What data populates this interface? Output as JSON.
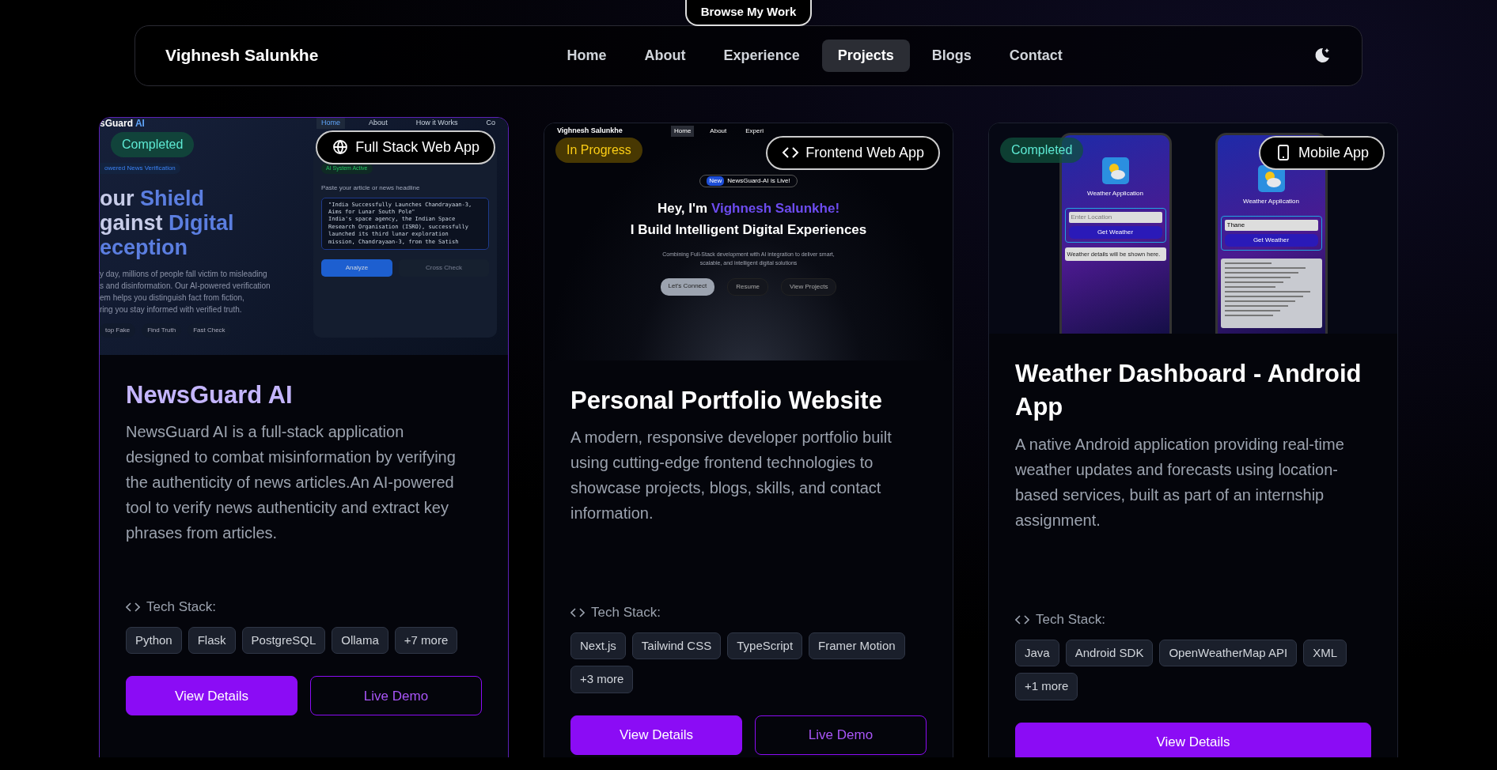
{
  "top_pill": {
    "label": "Browse My Work"
  },
  "navbar": {
    "brand": "Vighnesh Salunkhe",
    "links": [
      {
        "label": "Home",
        "selected": false
      },
      {
        "label": "About",
        "selected": false
      },
      {
        "label": "Experience",
        "selected": false
      },
      {
        "label": "Projects",
        "selected": true
      },
      {
        "label": "Blogs",
        "selected": false
      },
      {
        "label": "Contact",
        "selected": false
      }
    ]
  },
  "projects": [
    {
      "hovered": true,
      "status": {
        "label": "Completed",
        "kind": "completed"
      },
      "type": {
        "label": "Full Stack Web App",
        "kind": "web"
      },
      "preview": {
        "kind": "newsguard",
        "logo": "sGuard",
        "logo_accent": "AI",
        "nav": [
          {
            "label": "Home",
            "selected": true
          },
          {
            "label": "About",
            "selected": false
          },
          {
            "label": "How it Works",
            "selected": false
          },
          {
            "label": "Co",
            "selected": false
          }
        ],
        "badge": "owered News Verification",
        "heading_lines": [
          [
            {
              "text": "our ",
              "accent": false
            },
            {
              "text": "Shield",
              "accent": true
            }
          ],
          [
            {
              "text": "gainst ",
              "accent": false
            },
            {
              "text": "Digital",
              "accent": true
            }
          ],
          [
            {
              "text": "eception",
              "accent": true
            }
          ]
        ],
        "paragraph_lines": [
          "y day, millions of people fall victim to misleading",
          "s and disinformation. Our AI-powered verification",
          "em helps you distinguish fact from fiction,",
          "ring you stay informed with verified truth."
        ],
        "chips": [
          "top Fake",
          "Find Truth",
          "Fast Check"
        ],
        "panel_status": "AI System Active",
        "panel_label": "Paste your article or news headline",
        "textarea_lines": [
          "\"India Successfully Launches Chandrayaan-3,",
          "Aims for Lunar South Pole\"",
          "India's space agency, the Indian Space",
          "Research Organisation (ISRO), successfully",
          "launched its third lunar exploration",
          "mission, Chandrayaan-3, from the Satish"
        ],
        "analyze": "Analyze",
        "cross_check": "Cross Check"
      },
      "title": "NewsGuard AI",
      "description": "NewsGuard AI is a full-stack application designed to combat misinformation by verifying the authenticity of news articles.An AI-powered tool to verify news authenticity and extract key phrases from articles.",
      "tech_label": "Tech Stack:",
      "tech": [
        "Python",
        "Flask",
        "PostgreSQL",
        "Ollama",
        "+7 more"
      ],
      "buttons": [
        {
          "label": "View Details",
          "kind": "primary"
        },
        {
          "label": "Live Demo",
          "kind": "outline"
        }
      ]
    },
    {
      "hovered": false,
      "status": {
        "label": "In Progress",
        "kind": "progress"
      },
      "type": {
        "label": "Frontend Web App",
        "kind": "code"
      },
      "preview": {
        "kind": "portfolio",
        "brand": "Vighnesh Salunkhe",
        "nav": [
          {
            "label": "Home",
            "selected": true
          },
          {
            "label": "About",
            "selected": false
          },
          {
            "label": "Experi",
            "selected": false
          }
        ],
        "pill_tag": "New",
        "pill_text": "NewsGuard-AI is Live!",
        "intro": "Hey, I'm ",
        "name": "Vighnesh Salunkhe!",
        "headline": "I Build Intelligent Digital Experiences",
        "subtitle": "Combining Full-Stack development with AI integration to deliver smart, scalable, and intelligent digital solutions",
        "buttons": [
          "Let's Connect",
          "Resume",
          "View Projects"
        ]
      },
      "title": "Personal Portfolio Website",
      "description": "A modern, responsive developer portfolio built using cutting-edge frontend technologies to showcase projects, blogs, skills, and contact information.",
      "tech_label": "Tech Stack:",
      "tech": [
        "Next.js",
        "Tailwind CSS",
        "TypeScript",
        "Framer Motion",
        "+3 more"
      ],
      "buttons": [
        {
          "label": "View Details",
          "kind": "primary"
        },
        {
          "label": "Live Demo",
          "kind": "outline"
        }
      ]
    },
    {
      "hovered": false,
      "status": {
        "label": "Completed",
        "kind": "completed"
      },
      "type": {
        "label": "Mobile App",
        "kind": "mobile"
      },
      "preview": {
        "kind": "weather",
        "phones": [
          {
            "title": "Weather Application",
            "placeholder": "Enter Location",
            "button": "Get Weather",
            "result": "Weather details will be shown here."
          },
          {
            "title": "Weather Application",
            "value": "Thane",
            "button": "Get Weather"
          }
        ]
      },
      "title": "Weather Dashboard - Android App",
      "description": "A native Android application providing real-time weather updates and forecasts using location-based services, built as part of an internship assignment.",
      "tech_label": "Tech Stack:",
      "tech": [
        "Java",
        "Android SDK",
        "OpenWeatherMap API",
        "XML",
        "+1 more"
      ],
      "buttons": [
        {
          "label": "View Details",
          "kind": "primary"
        }
      ]
    }
  ]
}
